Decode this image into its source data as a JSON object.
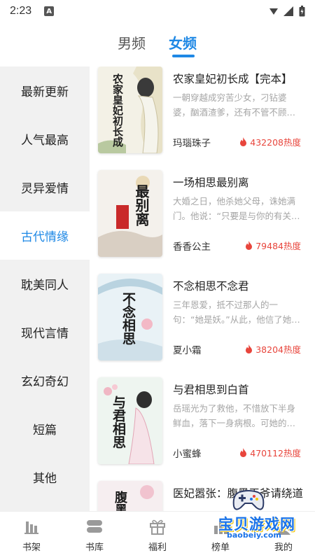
{
  "status_bar": {
    "time": "2:23",
    "notif_icon": "A"
  },
  "top_tabs": {
    "male": "男频",
    "female": "女频",
    "active": "female"
  },
  "sidebar": {
    "items": [
      {
        "label": "最新更新",
        "active": false
      },
      {
        "label": "人气最高",
        "active": false
      },
      {
        "label": "灵异爱情",
        "active": false
      },
      {
        "label": "古代情缘",
        "active": true
      },
      {
        "label": "耽美同人",
        "active": false
      },
      {
        "label": "现代言情",
        "active": false
      },
      {
        "label": "玄幻奇幻",
        "active": false
      },
      {
        "label": "短篇",
        "active": false
      },
      {
        "label": "其他",
        "active": false
      }
    ]
  },
  "books": [
    {
      "title": "农家皇妃初长成【完本】",
      "desc": "一朝穿越成穷苦少女，刁钻婆婆，酗酒渣爹，还有不管不顾…",
      "author": "玛瑙珠子",
      "heat": "432208热度",
      "cover_title": "农家皇妃初长成"
    },
    {
      "title": "一场相思最别离",
      "desc": "大婚之日，他杀她父母，诛她满门。他说：“只要是与你的有关…",
      "author": "香香公主",
      "heat": "79484热度",
      "cover_title": "最别离"
    },
    {
      "title": "不念相思不念君",
      "desc": "三年恩爱，抵不过那人的一句：“她是妖。”从此，他信了她…",
      "author": "夏小霜",
      "heat": "38204热度",
      "cover_title": "不念相思"
    },
    {
      "title": "与君相思到白首",
      "desc": "岳瑶光为了救他，不惜放下半身鲜血，落下一身病根。可她的…",
      "author": "小蜜蜂",
      "heat": "470112热度",
      "cover_title": "与君相思"
    },
    {
      "title": "医妃嚣张：腹黑王爷请绕道",
      "desc": "",
      "author": "",
      "heat": "",
      "cover_title": "腹黑"
    }
  ],
  "bottom_nav": [
    {
      "label": "书架",
      "icon": "bookshelf-icon"
    },
    {
      "label": "书库",
      "icon": "library-icon"
    },
    {
      "label": "福利",
      "icon": "gift-icon"
    },
    {
      "label": "榜单",
      "icon": "rank-icon"
    },
    {
      "label": "我的",
      "icon": "profile-icon"
    }
  ],
  "watermark": {
    "text": "宝贝游戏网",
    "url": "baobeiy.com"
  },
  "colors": {
    "accent": "#1e88e5",
    "heat": "#e8453c",
    "sidebar_bg": "#f1f1f1"
  }
}
